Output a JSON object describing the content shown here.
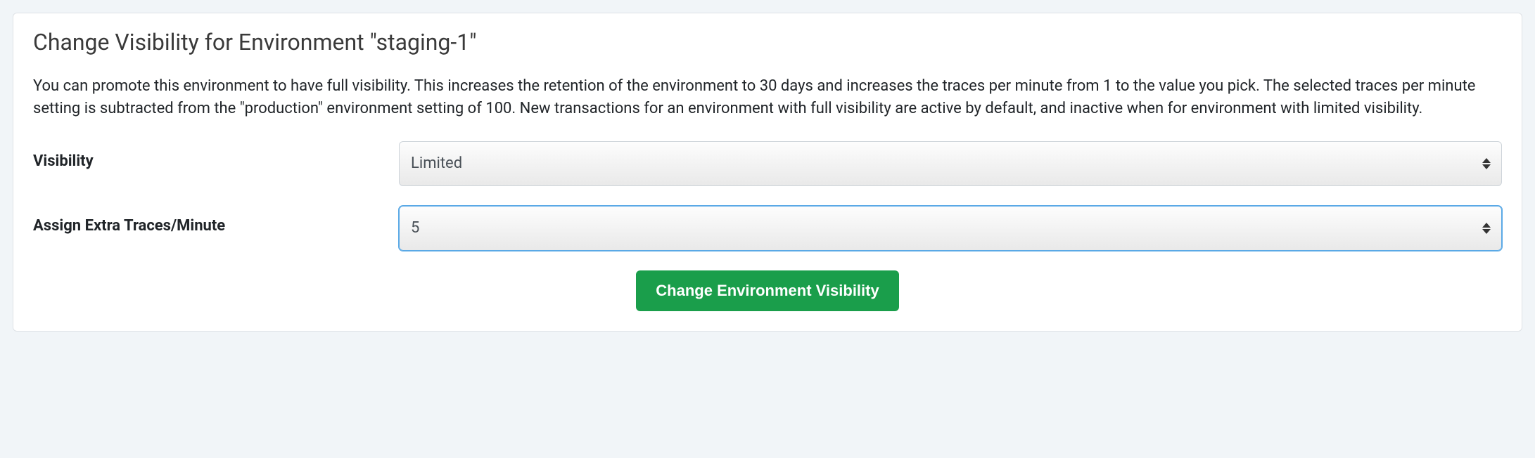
{
  "card": {
    "title": "Change Visibility for Environment \"staging-1\"",
    "description": "You can promote this environment to have full visibility. This increases the retention of the environment to 30 days and increases the traces per minute from 1 to the value you pick. The selected traces per minute setting is subtracted from the \"production\" environment setting of 100. New transactions for an environment with full visibility are active by default, and inactive when for environment with limited visibility."
  },
  "form": {
    "visibility": {
      "label": "Visibility",
      "value": "Limited"
    },
    "traces": {
      "label": "Assign Extra Traces/Minute",
      "value": "5"
    },
    "submit_label": "Change Environment Visibility"
  }
}
